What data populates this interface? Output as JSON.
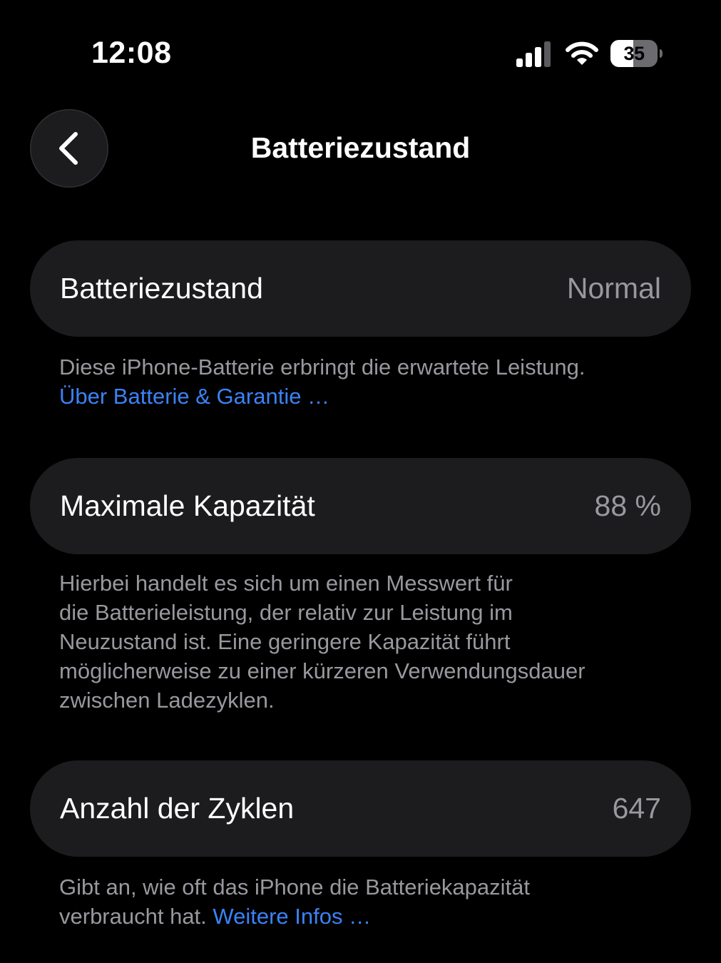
{
  "status_bar": {
    "time": "12:08",
    "battery_level": "35",
    "signal_bars": 4,
    "signal_bars_active": 3
  },
  "nav": {
    "title": "Batteriezustand",
    "back_icon": "chevron-left-icon"
  },
  "health": {
    "label": "Batteriezustand",
    "value": "Normal",
    "footnote": "Diese iPhone-Batterie erbringt die erwartete Leistung.",
    "link": "Über Batterie & Garantie …"
  },
  "capacity": {
    "label": "Maximale Kapazität",
    "value": "88 %",
    "footnote_lines": [
      "Hierbei handelt es sich um einen Messwert für",
      "die Batterieleistung, der relativ zur Leistung im",
      "Neuzustand ist. Eine geringere Kapazität führt",
      "möglicherweise zu einer kürzeren Verwendungsdauer",
      "zwischen Ladezyklen."
    ]
  },
  "cycles": {
    "label": "Anzahl der Zyklen",
    "value": "647",
    "footnote_line1": "Gibt an, wie oft das iPhone die Batteriekapazität",
    "footnote_line2": "verbraucht hat.",
    "link": "Weitere Infos …"
  },
  "colors": {
    "background": "#000000",
    "card": "#1c1c1e",
    "secondary_text": "#98989e",
    "link": "#3b82f6"
  }
}
